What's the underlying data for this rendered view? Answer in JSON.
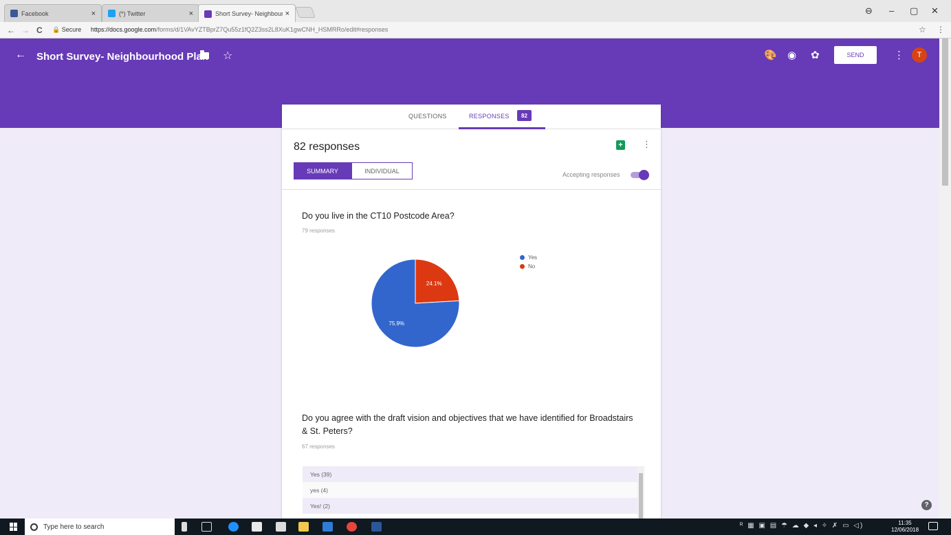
{
  "browser": {
    "tabs": [
      {
        "title": "Facebook",
        "color": "#3b5998"
      },
      {
        "title": "(*) Twitter",
        "color": "#1da1f2"
      },
      {
        "title": "Short Survey- Neighbour",
        "color": "#673ab7"
      }
    ],
    "close_glyph": "×",
    "window_controls": [
      "⊖",
      "–",
      "▢",
      "✕"
    ],
    "back": "←",
    "forward": "→",
    "reload": "C",
    "secure_label": "🔒 Secure",
    "url_host": "https://docs.google.com",
    "url_path": "/forms/d/1VAvYZTBprZ7Qu55z1fQ2Z3ss2L8XuK1gwCNH_HSMRRo/edit#responses",
    "bookmark_icon": "☆",
    "menu_icon": "⋮"
  },
  "header": {
    "back_icon": "←",
    "title": "Short Survey- Neighbourhood Plan",
    "star_icon": "☆",
    "palette_icon": "🎨",
    "preview_icon": "◉",
    "settings_icon": "✿",
    "send_label": "SEND",
    "more_icon": "⋮",
    "avatar_letter": "T",
    "accent": "#673ab7"
  },
  "form_tabs": {
    "questions_label": "QUESTIONS",
    "responses_label": "RESPONSES",
    "responses_badge": "82"
  },
  "responses": {
    "count_label": "82 responses",
    "sheets_icon": "+",
    "more_icon": "⋮",
    "summary_label": "SUMMARY",
    "individual_label": "INDIVIDUAL",
    "accepting_label": "Accepting responses",
    "accepting": true
  },
  "q1": {
    "text": "Do you live in the CT10 Postcode Area?",
    "count": "79 responses"
  },
  "chart_data": {
    "type": "pie",
    "slices": [
      {
        "label": "Yes",
        "value": 75.9,
        "display": "75.9%",
        "color": "#3366cc"
      },
      {
        "label": "No",
        "value": 24.1,
        "display": "24.1%",
        "color": "#dc3912"
      }
    ],
    "legend": [
      "Yes",
      "No"
    ],
    "legend_position": "right"
  },
  "q2": {
    "text": "Do you agree with the draft vision and objectives that we have identified for Broadstairs & St. Peters?",
    "count": "67 responses",
    "answers": [
      "Yes (39)",
      "yes (4)",
      "Yes! (2)"
    ]
  },
  "help_icon": "?",
  "taskbar": {
    "search_placeholder": "Type here to search",
    "time": "11:35",
    "date": "12/06/2018"
  }
}
